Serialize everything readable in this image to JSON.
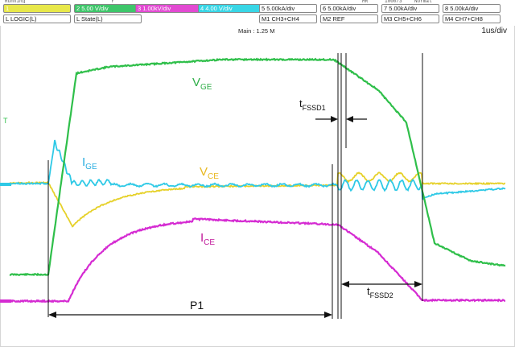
{
  "header": {
    "top_strip": [
      "Running",
      "Y",
      "HR",
      "1000/3",
      "Normal"
    ],
    "row1": [
      {
        "label": "1",
        "color": "#e8e84a",
        "text": ""
      },
      {
        "label": "2",
        "color": "#3ec66a",
        "text": "5.00 V/div"
      },
      {
        "label": "3",
        "color": "#e24ad2",
        "text": "1.00kV/div"
      },
      {
        "label": "4",
        "color": "#38d6e6",
        "text": "4.00 V/div"
      },
      {
        "label": "5",
        "color": "#ffffff",
        "text": "5.00kA/div"
      },
      {
        "label": "6",
        "color": "#ffffff",
        "text": "5.00kA/div"
      },
      {
        "label": "7",
        "color": "#ffffff",
        "text": "5.00kA/div"
      },
      {
        "label": "8",
        "color": "#ffffff",
        "text": "5.00kA/div"
      }
    ],
    "row2": [
      "L LOGIC(L)",
      "L State(L)",
      "M1 CH3+CH4",
      "M2 REF",
      "M3 CH5+CH6",
      "M4 CH7+CH8"
    ],
    "main_label": "Main : 1.25 M",
    "time_div": "1us/div"
  },
  "plot": {
    "trigger_marker": "T",
    "labels": {
      "vge_main": "V",
      "vge_sub": "GE",
      "ige_main": "I",
      "ige_sub": "GE",
      "vce_main": "V",
      "vce_sub": "CE",
      "ice_main": "I",
      "ice_sub": "CE",
      "t1_main": "t",
      "t1_sub": "FSSD1",
      "t2_main": "t",
      "t2_sub": "FSSD2",
      "p1": "P1"
    },
    "colors": {
      "vge": "#2fbf4a",
      "ige": "#2ec9e6",
      "vce": "#e6d12a",
      "ice": "#d52bd2",
      "ice_label": "#c0189a",
      "vge_label": "#2fae48",
      "ige_label": "#2aaee0",
      "vce_label": "#e8b820",
      "annotation": "#111111"
    }
  }
}
